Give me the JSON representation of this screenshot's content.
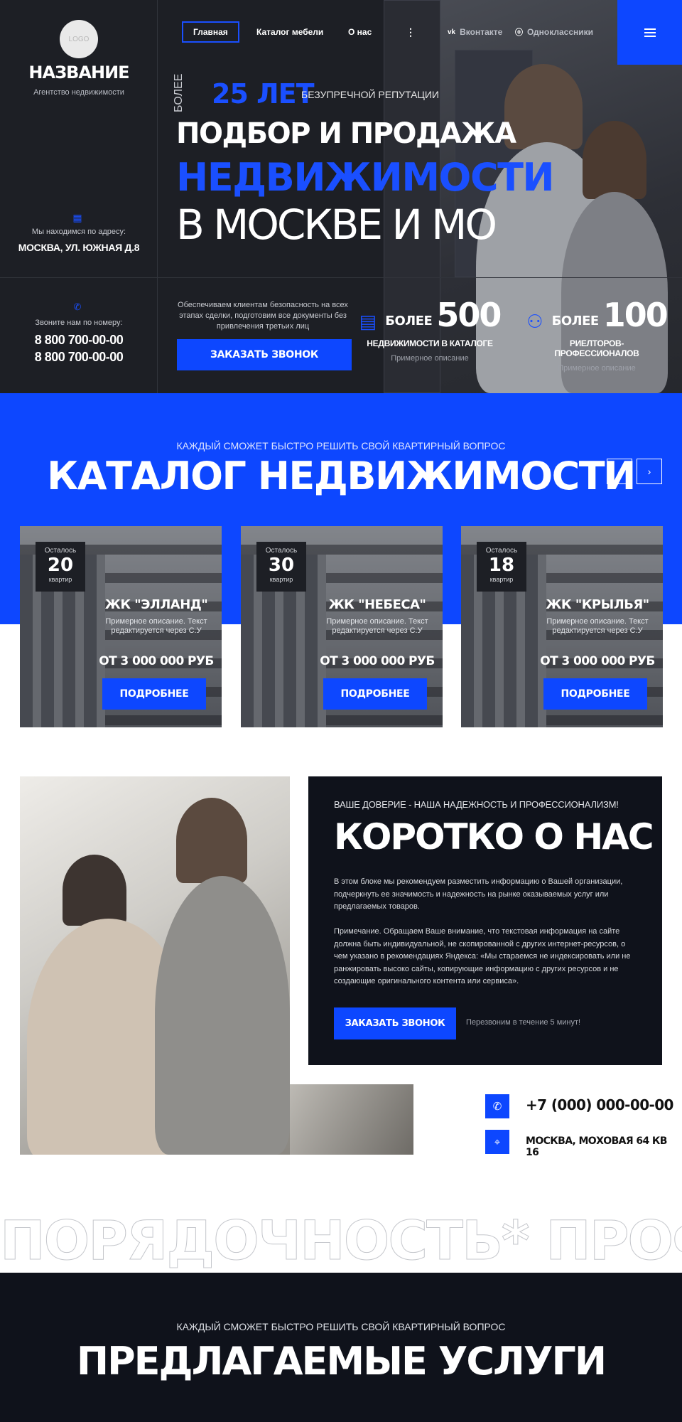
{
  "header": {
    "logo_text": "LOGO",
    "brand_name": "НАЗВАНИЕ",
    "brand_sub": "Агентство недвижимости",
    "address_label": "Мы находимся по адресу:",
    "address_value": "МОСКВА, УЛ. ЮЖНАЯ Д.8",
    "phone_label": "Звоните нам по номеру:",
    "phones": [
      "8 800 700-00-00",
      "8 800 700-00-00"
    ],
    "nav": [
      {
        "label": "Главная",
        "active": true
      },
      {
        "label": "Каталог мебели",
        "active": false
      },
      {
        "label": "О нас",
        "active": false
      }
    ],
    "more_icon": "more-vertical-icon",
    "social": [
      {
        "icon": "vk-icon",
        "label": "Вконтакте"
      },
      {
        "icon": "ok-icon",
        "label": "Одноклассники"
      }
    ],
    "menu_icon": "hamburger-icon"
  },
  "hero": {
    "vertical_label": "БОЛЕЕ",
    "years": "25 ЛЕТ",
    "years_sub": "БЕЗУПРЕЧНОЙ РЕПУТАЦИИ",
    "line1": "ПОДБОР И ПРОДАЖА",
    "line2": "НЕДВИЖИМОСТИ",
    "line3": "В МОСКВЕ И МО",
    "secure_text": "Обеспечиваем клиентам безопасность на всех этапах сделки, подготовим все документы без привлечения третьих лиц",
    "cta": "ЗАКАЗАТЬ ЗВОНОК",
    "stats": [
      {
        "icon": "buildings-icon",
        "prefix": "БОЛЕЕ",
        "number": "500",
        "title": "НЕДВИЖИМОСТИ В КАТАЛОГЕ",
        "desc": "Примерное описание"
      },
      {
        "icon": "team-icon",
        "prefix": "БОЛЕЕ",
        "number": "100",
        "title": "РИЕЛТОРОВ-ПРОФЕССИОНАЛОВ",
        "desc": "Примерное описание"
      }
    ]
  },
  "catalog": {
    "tagline": "КАЖДЫЙ СМОЖЕТ БЫСТРО РЕШИТЬ СВОЙ КВАРТИРНЫЙ ВОПРОС",
    "title": "КАТАЛОГ НЕДВИЖИМОСТИ",
    "cards": [
      {
        "left_label": "Осталось",
        "left_count": "20",
        "unit": "квартир",
        "name": "ЖК \"ЭЛЛАНД\"",
        "desc": "Примерное описание. Текст редактируется через С.У",
        "price": "ОТ 3 000 000 РУБ",
        "button": "ПОДРОБНЕЕ"
      },
      {
        "left_label": "Осталось",
        "left_count": "30",
        "unit": "квартир",
        "name": "ЖК \"НЕБЕСА\"",
        "desc": "Примерное описание. Текст редактируется через С.У",
        "price": "ОТ 3 000 000 РУБ",
        "button": "ПОДРОБНЕЕ"
      },
      {
        "left_label": "Осталось",
        "left_count": "18",
        "unit": "квартир",
        "name": "ЖК \"КРЫЛЬЯ\"",
        "desc": "Примерное описание. Текст редактируется через С.У",
        "price": "ОТ 3 000 000 РУБ",
        "button": "ПОДРОБНЕЕ"
      }
    ]
  },
  "about": {
    "tagline": "ВАШЕ ДОВЕРИЕ - НАША НАДЕЖНОСТЬ И ПРОФЕССИОНАЛИЗМ!",
    "title": "КОРОТКО О НАС",
    "p1": "В этом блоке мы рекомендуем разместить информацию о Вашей организации, подчеркнуть ее значимость и надежность на рынке оказываемых услуг или предлагаемых товаров.",
    "p2": "Примечание. Обращаем Ваше внимание, что текстовая информация на сайте должна быть индивидуальной, не скопированной с других интернет-ресурсов, о чем указано в рекомендациях Яндекса: «Мы стараемся не индексировать или не ранжировать высоко сайты, копирующие информацию с других ресурсов и не создающие оригинального контента или сервиса».",
    "cta": "ЗАКАЗАТЬ ЗВОНОК",
    "note": "Перезвоним в течение 5 минут!",
    "phone": "+7 (000) 000-00-00",
    "address": "МОСКВА, МОХОВАЯ 64 КВ 16"
  },
  "marquee": "ПОРЯДОЧНОСТЬ* ПРОФЕССИОНА",
  "services": {
    "tagline": "КАЖДЫЙ СМОЖЕТ БЫСТРО РЕШИТЬ СВОЙ КВАРТИРНЫЙ ВОПРОС",
    "title": "ПРЕДЛАГАЕМЫЕ УСЛУГИ"
  },
  "colors": {
    "accent": "#0d47ff",
    "dark": "#1d1f25",
    "navy": "#0f121b"
  }
}
